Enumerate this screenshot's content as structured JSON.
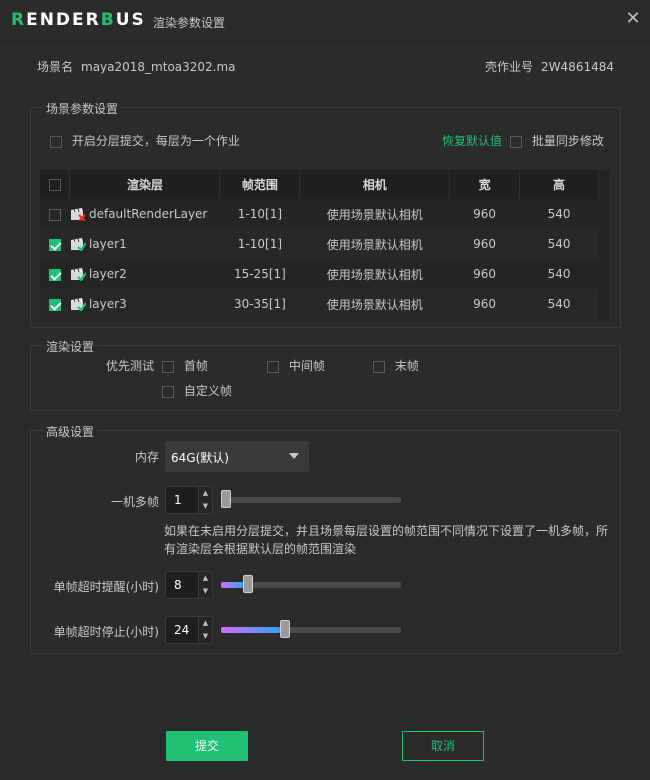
{
  "window": {
    "logo_part1": "R",
    "logo_part2": "ENDER",
    "logo_part3": "B",
    "logo_part4": "US",
    "title": "渲染参数设置",
    "close_icon": "close-icon"
  },
  "info": {
    "scene_label": "场景名",
    "scene_value": "maya2018_mtoa3202.ma",
    "job_label": "壳作业号",
    "job_value": "2W4861484"
  },
  "scene_settings": {
    "title": "场景参数设置",
    "layered_submit_label": "开启分层提交，每层为一个作业",
    "layered_submit_checked": false,
    "restore_default_label": "恢复默认值",
    "batch_sync_label": "批量同步修改",
    "batch_sync_checked": false,
    "table": {
      "headers": [
        "渲染层",
        "帧范围",
        "相机",
        "宽",
        "高"
      ],
      "header_checked": false,
      "rows": [
        {
          "checked": false,
          "name": "defaultRenderLayer",
          "icon": "clapper-red-icon",
          "frames": "1-10[1]",
          "camera": "使用场景默认相机",
          "width": "960",
          "height": "540"
        },
        {
          "checked": true,
          "name": "layer1",
          "icon": "clapper-green-icon",
          "frames": "1-10[1]",
          "camera": "使用场景默认相机",
          "width": "960",
          "height": "540"
        },
        {
          "checked": true,
          "name": "layer2",
          "icon": "clapper-green-icon",
          "frames": "15-25[1]",
          "camera": "使用场景默认相机",
          "width": "960",
          "height": "540"
        },
        {
          "checked": true,
          "name": "layer3",
          "icon": "clapper-green-icon",
          "frames": "30-35[1]",
          "camera": "使用场景默认相机",
          "width": "960",
          "height": "540"
        }
      ]
    }
  },
  "render_settings": {
    "title": "渲染设置",
    "priority_label": "优先测试",
    "options": {
      "first": "首帧",
      "middle": "中间帧",
      "last": "末帧",
      "custom": "自定义帧"
    }
  },
  "advanced": {
    "title": "高级设置",
    "memory_label": "内存",
    "memory_value": "64G(默认)",
    "multi_frame_label": "一机多帧",
    "multi_frame_value": "1",
    "multi_frame_level": 0.0,
    "hint": "如果在未启用分层提交，并且场景每层设置的帧范围不同情况下设置了一机多帧，所有渲染层会根据默认层的帧范围渲染",
    "timeout_warn_label": "单帧超时提醒(小时)",
    "timeout_warn_value": "8",
    "timeout_warn_level": 0.12,
    "timeout_stop_label": "单帧超时停止(小时)",
    "timeout_stop_value": "24",
    "timeout_stop_level": 0.33
  },
  "buttons": {
    "submit": "提交",
    "cancel": "取消"
  },
  "colors": {
    "accent": "#1fbf74",
    "background": "#2b2b2b"
  }
}
